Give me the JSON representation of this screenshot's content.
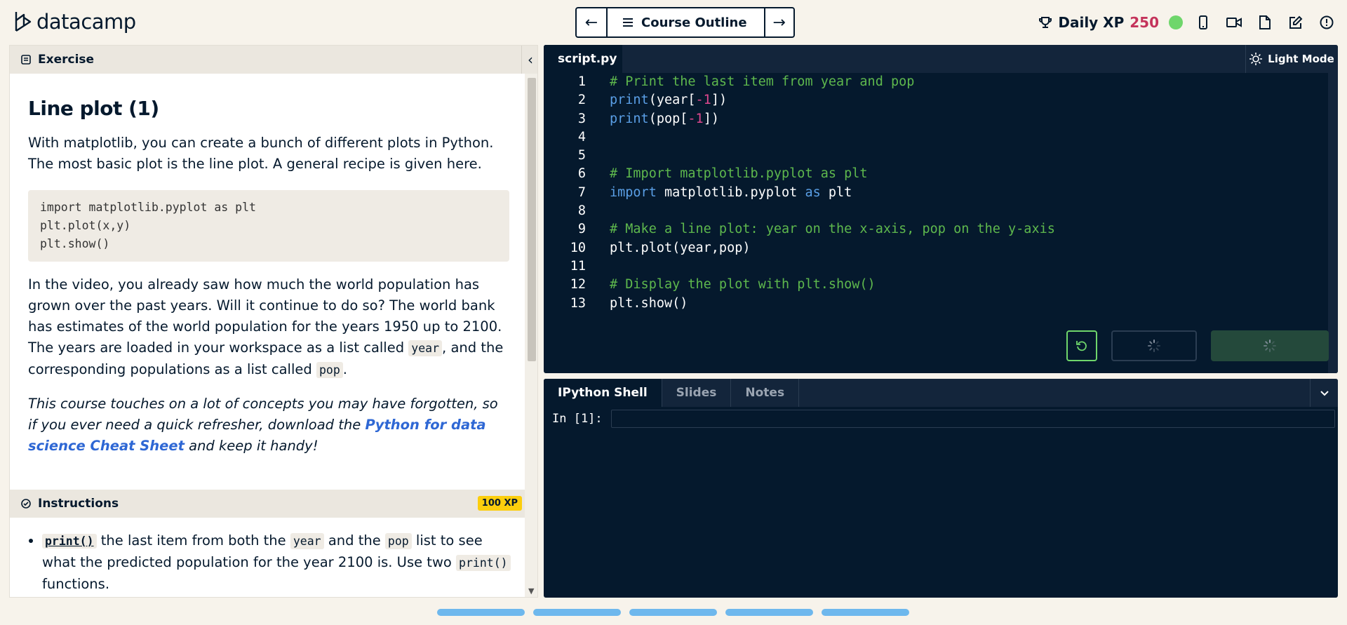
{
  "header": {
    "logo_text": "datacamp",
    "outline_label": "Course Outline",
    "xp_label": "Daily XP",
    "xp_value": "250",
    "colors": {
      "xp_value": "#c4335b",
      "status": "#6fd66b"
    }
  },
  "exercise": {
    "panel_label": "Exercise",
    "title": "Line plot (1)",
    "intro": "With matplotlib, you can create a bunch of different plots in Python. The most basic plot is the line plot. A general recipe is given here.",
    "code_lines": [
      "import matplotlib.pyplot as plt",
      "plt.plot(x,y)",
      "plt.show()"
    ],
    "para2_a": "In the video, you already saw how much the world population has grown over the past years. Will it continue to do so? The world bank has estimates of the world population for the years 1950 up to 2100. The years are loaded in your workspace as a list called ",
    "para2_code1": "year",
    "para2_b": ", and the corresponding populations as a list called ",
    "para2_code2": "pop",
    "para2_c": ".",
    "tip_a": "This course touches on a lot of concepts you may have forgotten, so if you ever need a quick refresher, download the ",
    "tip_link": "Python for data science Cheat Sheet",
    "tip_b": " and keep it handy!"
  },
  "instructions": {
    "label": "Instructions",
    "xp_badge": "100 XP",
    "item1_fn": "print()",
    "item1_a": " the last item from both the ",
    "item1_code1": "year",
    "item1_b": " and the ",
    "item1_code2": "pop",
    "item1_c": " list to see what the predicted population for the year 2100 is. Use two ",
    "item1_code3": "print()",
    "item1_d": " functions."
  },
  "editor": {
    "file_tab": "script.py",
    "mode_label": "Light Mode",
    "line_numbers": [
      "1",
      "2",
      "3",
      "4",
      "5",
      "6",
      "7",
      "8",
      "9",
      "10",
      "11",
      "12",
      "13"
    ]
  },
  "console": {
    "tabs": [
      "IPython Shell",
      "Slides",
      "Notes"
    ],
    "prompt": "In [1]:"
  }
}
